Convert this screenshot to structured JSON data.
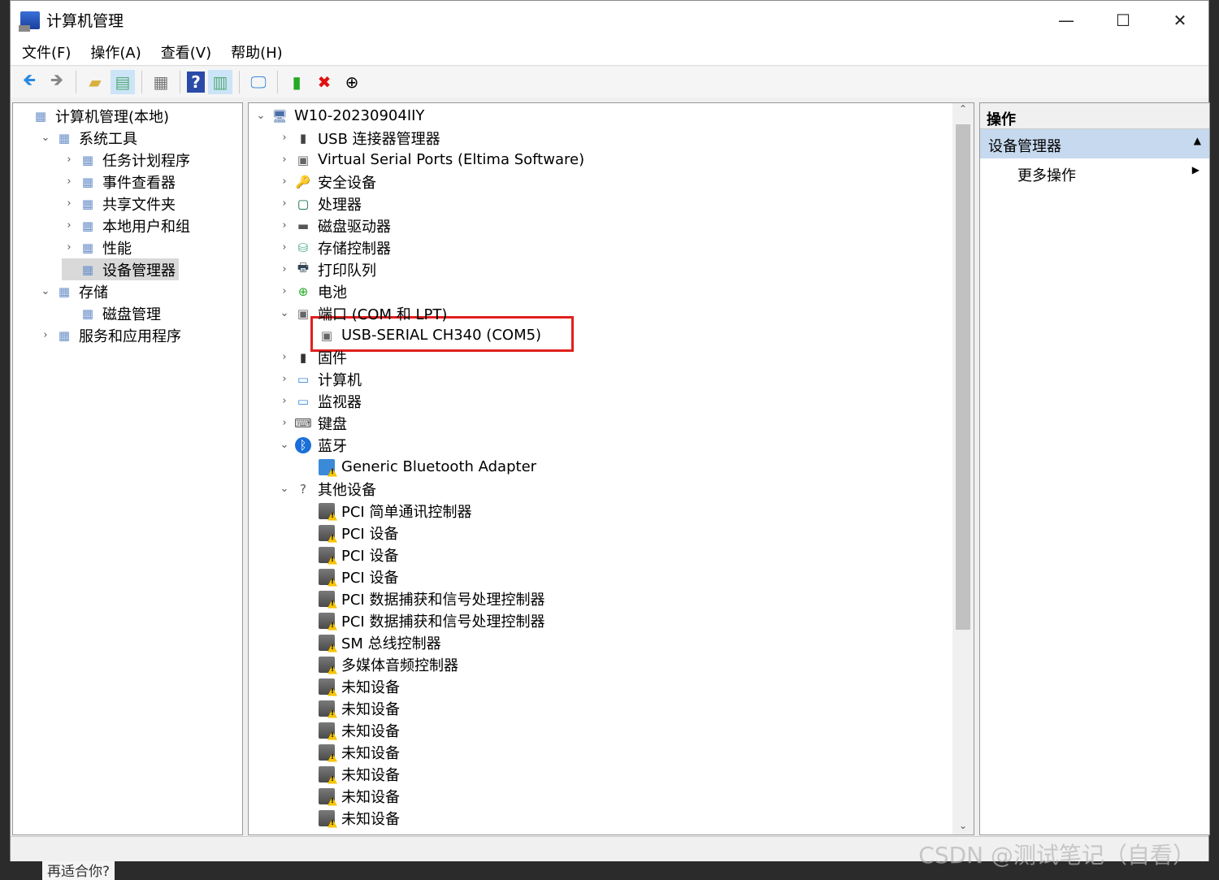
{
  "window": {
    "title": "计算机管理",
    "minimize": "—",
    "maximize": "☐",
    "close": "✕"
  },
  "menu": [
    "文件(F)",
    "操作(A)",
    "查看(V)",
    "帮助(H)"
  ],
  "toolbar": [
    "back-icon",
    "forward-icon",
    "up-folder-icon",
    "show-hide-tree-icon",
    "properties-icon",
    "help-icon",
    "show-hide-action-icon",
    "scan-hardware-icon",
    "update-driver-icon",
    "uninstall-icon",
    "disable-icon"
  ],
  "left_tree": [
    {
      "label": "计算机管理(本地)",
      "level": 0,
      "chev": ""
    },
    {
      "label": "系统工具",
      "level": 1,
      "chev": "⌄"
    },
    {
      "label": "任务计划程序",
      "level": 2,
      "chev": "›"
    },
    {
      "label": "事件查看器",
      "level": 2,
      "chev": "›"
    },
    {
      "label": "共享文件夹",
      "level": 2,
      "chev": "›"
    },
    {
      "label": "本地用户和组",
      "level": 2,
      "chev": "›"
    },
    {
      "label": "性能",
      "level": 2,
      "chev": "›"
    },
    {
      "label": "设备管理器",
      "level": 2,
      "chev": "",
      "selected": true
    },
    {
      "label": "存储",
      "level": 1,
      "chev": "⌄"
    },
    {
      "label": "磁盘管理",
      "level": 2,
      "chev": ""
    },
    {
      "label": "服务和应用程序",
      "level": 1,
      "chev": "›"
    }
  ],
  "device_tree": [
    {
      "label": "W10-20230904IIY",
      "level": 0,
      "chev": "⌄",
      "icon": "computer"
    },
    {
      "label": "USB 连接器管理器",
      "level": 1,
      "chev": "›",
      "icon": "usb"
    },
    {
      "label": "Virtual Serial Ports (Eltima Software)",
      "level": 1,
      "chev": "›",
      "icon": "port"
    },
    {
      "label": "安全设备",
      "level": 1,
      "chev": "›",
      "icon": "security"
    },
    {
      "label": "处理器",
      "level": 1,
      "chev": "›",
      "icon": "cpu"
    },
    {
      "label": "磁盘驱动器",
      "level": 1,
      "chev": "›",
      "icon": "disk"
    },
    {
      "label": "存储控制器",
      "level": 1,
      "chev": "›",
      "icon": "storage"
    },
    {
      "label": "打印队列",
      "level": 1,
      "chev": "›",
      "icon": "printer"
    },
    {
      "label": "电池",
      "level": 1,
      "chev": "›",
      "icon": "battery"
    },
    {
      "label": "端口 (COM 和 LPT)",
      "level": 1,
      "chev": "⌄",
      "icon": "port"
    },
    {
      "label": "USB-SERIAL CH340 (COM5)",
      "level": 2,
      "chev": "",
      "icon": "port",
      "highlight": true
    },
    {
      "label": "固件",
      "level": 1,
      "chev": "›",
      "icon": "firmware"
    },
    {
      "label": "计算机",
      "level": 1,
      "chev": "›",
      "icon": "monitor"
    },
    {
      "label": "监视器",
      "level": 1,
      "chev": "›",
      "icon": "monitor"
    },
    {
      "label": "键盘",
      "level": 1,
      "chev": "›",
      "icon": "keyboard"
    },
    {
      "label": "蓝牙",
      "level": 1,
      "chev": "⌄",
      "icon": "bluetooth"
    },
    {
      "label": "Generic Bluetooth Adapter",
      "level": 2,
      "chev": "",
      "icon": "bt-warn"
    },
    {
      "label": "其他设备",
      "level": 1,
      "chev": "⌄",
      "icon": "other"
    },
    {
      "label": "PCI 简单通讯控制器",
      "level": 2,
      "chev": "",
      "icon": "warn"
    },
    {
      "label": "PCI 设备",
      "level": 2,
      "chev": "",
      "icon": "warn"
    },
    {
      "label": "PCI 设备",
      "level": 2,
      "chev": "",
      "icon": "warn"
    },
    {
      "label": "PCI 设备",
      "level": 2,
      "chev": "",
      "icon": "warn"
    },
    {
      "label": "PCI 数据捕获和信号处理控制器",
      "level": 2,
      "chev": "",
      "icon": "warn"
    },
    {
      "label": "PCI 数据捕获和信号处理控制器",
      "level": 2,
      "chev": "",
      "icon": "warn"
    },
    {
      "label": "SM 总线控制器",
      "level": 2,
      "chev": "",
      "icon": "warn"
    },
    {
      "label": "多媒体音频控制器",
      "level": 2,
      "chev": "",
      "icon": "warn"
    },
    {
      "label": "未知设备",
      "level": 2,
      "chev": "",
      "icon": "warn"
    },
    {
      "label": "未知设备",
      "level": 2,
      "chev": "",
      "icon": "warn"
    },
    {
      "label": "未知设备",
      "level": 2,
      "chev": "",
      "icon": "warn"
    },
    {
      "label": "未知设备",
      "level": 2,
      "chev": "",
      "icon": "warn"
    },
    {
      "label": "未知设备",
      "level": 2,
      "chev": "",
      "icon": "warn"
    },
    {
      "label": "未知设备",
      "level": 2,
      "chev": "",
      "icon": "warn"
    },
    {
      "label": "未知设备",
      "level": 2,
      "chev": "",
      "icon": "warn"
    }
  ],
  "actions": {
    "header": "操作",
    "section": "设备管理器",
    "more": "更多操作"
  },
  "watermark": "CSDN @测试笔记（自看）",
  "below_text": "再适合你?",
  "colors": {
    "highlight_box": "#e0201e",
    "action_section": "#c6d9ee"
  }
}
